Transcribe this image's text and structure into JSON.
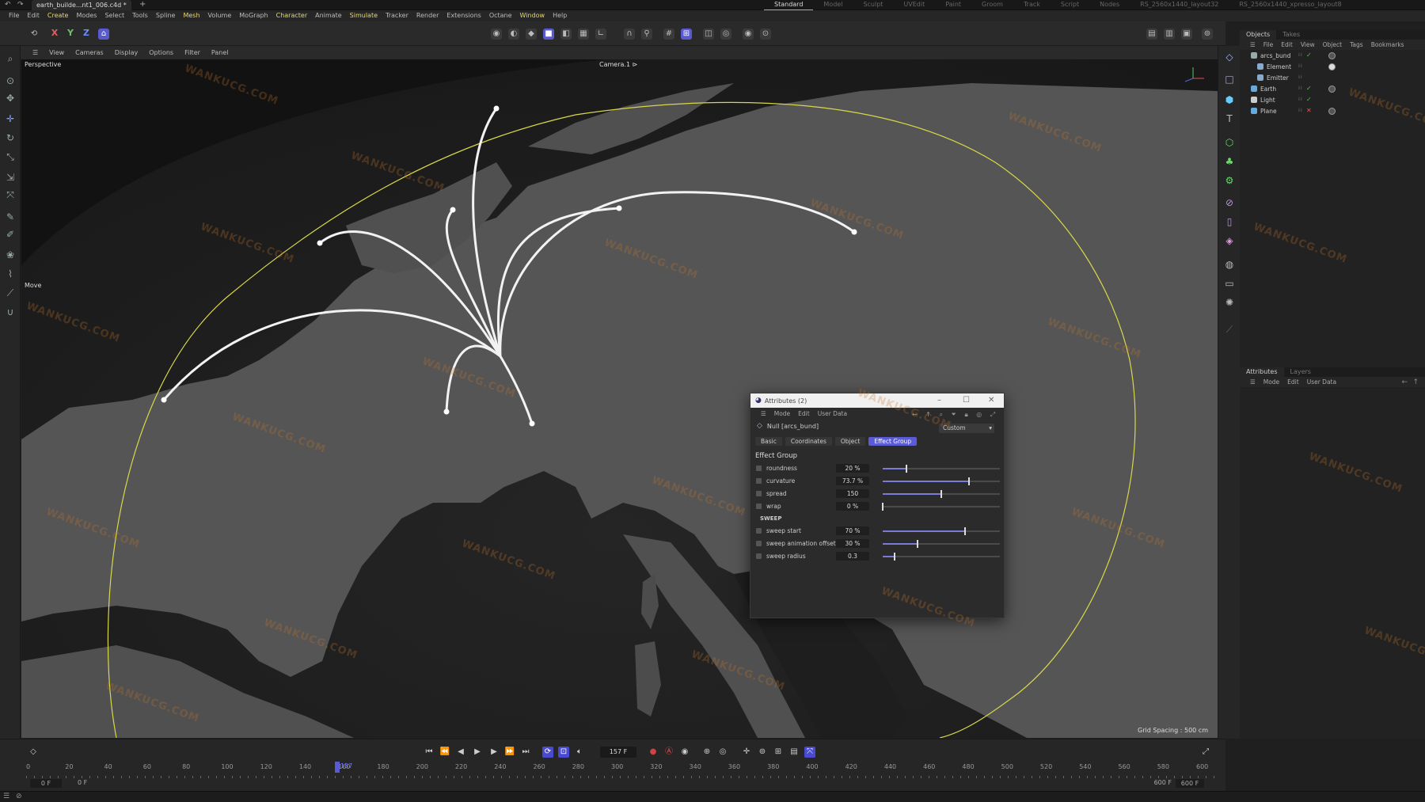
{
  "window": {
    "file_tab": "earth_builde...nt1_006.c4d *",
    "add_tab": "+",
    "layouts": [
      "Standard",
      "Model",
      "Sculpt",
      "UVEdit",
      "Paint",
      "Groom",
      "Track",
      "Script",
      "Nodes",
      "RS_2560x1440_layout32",
      "RS_2560x1440_xpresso_layout8"
    ],
    "active_layout": "Standard"
  },
  "menubar": [
    "File",
    "Edit",
    "Create",
    "Modes",
    "Select",
    "Tools",
    "Spline",
    "Mesh",
    "Volume",
    "MoGraph",
    "Character",
    "Animate",
    "Simulate",
    "Tracker",
    "Render",
    "Extensions",
    "Octane",
    "Window",
    "Help"
  ],
  "toolbar": {
    "axis_x": "X",
    "axis_y": "Y",
    "axis_z": "Z"
  },
  "viewport": {
    "menu": [
      "View",
      "Cameras",
      "Display",
      "Options",
      "Filter",
      "Panel"
    ],
    "projection": "Perspective",
    "camera": "Camera.1 ⊳",
    "tool_hint": "Move",
    "grid_spacing": "Grid Spacing : 500 cm"
  },
  "objects_panel": {
    "tabs": [
      "Objects",
      "Takes"
    ],
    "menu": [
      "File",
      "Edit",
      "View",
      "Object",
      "Tags",
      "Bookmarks"
    ],
    "items": [
      {
        "name": "arcs_bund",
        "indent": 0,
        "color": "#9aa"
      },
      {
        "name": "Element",
        "indent": 1,
        "color": "#8ac"
      },
      {
        "name": "Emitter",
        "indent": 1,
        "color": "#8ac"
      },
      {
        "name": "Earth",
        "indent": 0,
        "color": "#6ad"
      },
      {
        "name": "Light",
        "indent": 0,
        "color": "#ccc"
      },
      {
        "name": "Plane",
        "indent": 0,
        "color": "#6ad"
      }
    ]
  },
  "attributes_panel": {
    "tabs": [
      "Attributes",
      "Layers"
    ],
    "menu": [
      "Mode",
      "Edit",
      "User Data"
    ]
  },
  "dialog": {
    "title": "Attributes (2)",
    "menu": [
      "Mode",
      "Edit",
      "User Data"
    ],
    "object": "Null [arcs_bund]",
    "preset": "Custom",
    "tabs": [
      "Basic",
      "Coordinates",
      "Object",
      "Effect Group"
    ],
    "active_tab": "Effect Group",
    "group_title": "Effect Group",
    "params": [
      {
        "name": "roundness",
        "value": "20 %",
        "fraction": 0.2
      },
      {
        "name": "curvature",
        "value": "73.7 %",
        "fraction": 0.737
      },
      {
        "name": "spread",
        "value": "150",
        "fraction": 0.5
      },
      {
        "name": "wrap",
        "value": "0 %",
        "fraction": 0.0
      }
    ],
    "sweep_title": "SWEEP",
    "sweep_params": [
      {
        "name": "sweep start",
        "value": "70 %",
        "fraction": 0.7
      },
      {
        "name": "sweep animation offset",
        "value": "30 %",
        "fraction": 0.3
      },
      {
        "name": "sweep radius",
        "value": "0.3",
        "fraction": 0.1
      }
    ]
  },
  "timeline": {
    "current_frame": "157 F",
    "playhead_label": "157",
    "start": "0 F",
    "start2": "0 F",
    "end": "600 F",
    "end2": "600 F",
    "ticks": [
      "0",
      "20",
      "40",
      "60",
      "80",
      "100",
      "120",
      "140",
      "160",
      "180",
      "200",
      "220",
      "240",
      "260",
      "280",
      "300",
      "320",
      "340",
      "360",
      "380",
      "400",
      "420",
      "440",
      "460",
      "480",
      "500",
      "520",
      "540",
      "560",
      "580",
      "600"
    ]
  },
  "watermark": "WANKUCG.COM",
  "colors": {
    "accent": "#5b5bd6",
    "highlight_menu": "#e8d86a",
    "land": "#5a5a5a",
    "sea": "#1e1e1e",
    "arc": "#ffffff",
    "boundary": "#d8d84a"
  }
}
